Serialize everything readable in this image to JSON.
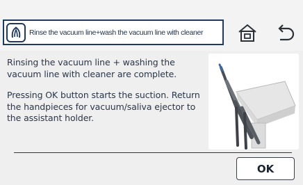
{
  "header": {
    "title": "Rinse the vacuum line+wash the vacuum line with cleaner",
    "title_icon": "vacuum-handpiece-icon",
    "home_icon": "home-icon",
    "back_icon": "back-arrow-icon"
  },
  "message": {
    "line1": "Rinsing the vacuum line + washing the vacuum line with cleaner are complete.",
    "line2": "Pressing OK button starts the suction. Return the handpieces for vacuum/saliva ejector to the assistant holder."
  },
  "illustration": "assistant-holder-handpieces-image",
  "buttons": {
    "ok": "OK"
  },
  "colors": {
    "frame": "#1f3a5c",
    "text": "#2a3647",
    "background": "#f0f0f0"
  }
}
